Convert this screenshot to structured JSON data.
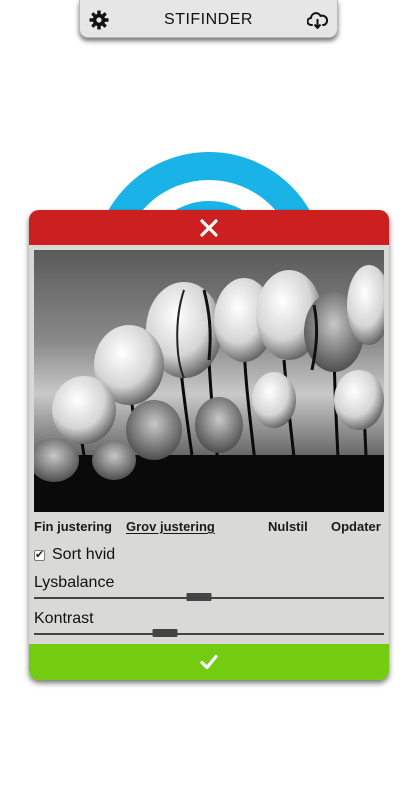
{
  "header": {
    "title": "STIFINDER",
    "left_icon": "gear-icon",
    "right_icon": "cloud-download-icon"
  },
  "background": {
    "logo_color": "#1ab3e8"
  },
  "modal": {
    "close_icon": "close-icon",
    "header_color": "#cc1f1f",
    "image": {
      "subject": "tulips",
      "filter": "grayscale"
    },
    "tabs": {
      "fine": "Fin justering",
      "coarse": "Grov justering",
      "active": "coarse"
    },
    "actions": {
      "reset": "Nulstil",
      "update": "Opdater"
    },
    "bw_checkbox": {
      "label": "Sort hvid",
      "checked": true
    },
    "sliders": {
      "light_balance": {
        "label": "Lysbalance",
        "value": 0.47
      },
      "contrast": {
        "label": "Kontrast",
        "value": 0.375
      }
    },
    "confirm_icon": "checkmark-icon",
    "footer_color": "#73cc0f"
  }
}
